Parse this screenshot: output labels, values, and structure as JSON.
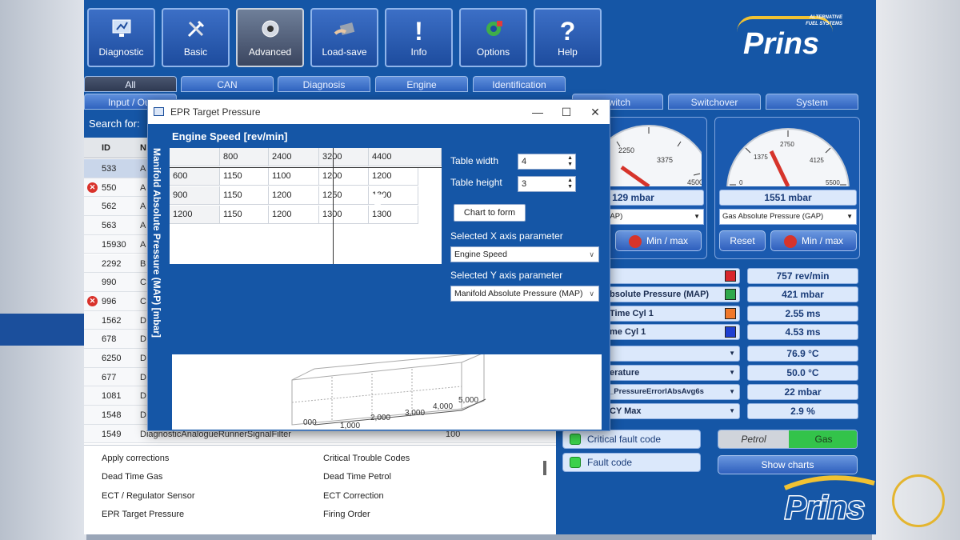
{
  "toolbar": {
    "buttons": [
      {
        "label": "Diagnostic",
        "icon": "monitor-icon"
      },
      {
        "label": "Basic",
        "icon": "wrench-icon"
      },
      {
        "label": "Advanced",
        "icon": "gear-knob-icon"
      },
      {
        "label": "Load-save",
        "icon": "hand-disk-icon"
      },
      {
        "label": "Info",
        "icon": "exclamation-icon"
      },
      {
        "label": "Options",
        "icon": "options-icon"
      },
      {
        "label": "Help",
        "icon": "question-icon"
      }
    ],
    "active": "Advanced"
  },
  "logo": {
    "name": "Prins",
    "tagline_1": "ALTERNATIVE",
    "tagline_2": "FUEL SYSTEMS"
  },
  "tabs_top": [
    "All",
    "CAN",
    "Diagnosis",
    "Engine",
    "Identification"
  ],
  "tabs_second": [
    "Input / Out",
    "witch",
    "Switchover",
    "System"
  ],
  "search": {
    "label": "Search for:"
  },
  "id_table": {
    "headers": [
      "ID",
      "N"
    ],
    "rows": [
      {
        "id": "533",
        "name": "A",
        "error": false,
        "selected": true
      },
      {
        "id": "550",
        "name": "A",
        "error": true
      },
      {
        "id": "562",
        "name": "A",
        "error": false
      },
      {
        "id": "563",
        "name": "A",
        "error": false
      },
      {
        "id": "15930",
        "name": "A",
        "error": false
      },
      {
        "id": "2292",
        "name": "B",
        "error": false
      },
      {
        "id": "990",
        "name": "C",
        "error": false
      },
      {
        "id": "996",
        "name": "C",
        "error": true
      },
      {
        "id": "1562",
        "name": "D",
        "error": false
      },
      {
        "id": "678",
        "name": "D",
        "error": false
      },
      {
        "id": "6250",
        "name": "D",
        "error": false
      },
      {
        "id": "677",
        "name": "D",
        "error": false
      },
      {
        "id": "1081",
        "name": "D",
        "error": false
      },
      {
        "id": "1548",
        "name": "D",
        "error": false
      },
      {
        "id": "1549",
        "name": "DiagnosticAnalogueRunnerSignalFilter",
        "error": false,
        "value": "100"
      }
    ]
  },
  "descriptions": [
    "Apply corrections",
    "Critical Trouble Codes",
    "Dead Time Gas",
    "Dead Time Petrol",
    "ECT / Regulator Sensor",
    "ECT Correction",
    "EPR Target Pressure",
    "Firing Order"
  ],
  "gauges": [
    {
      "ticks": [
        "2250",
        "3375",
        "4500"
      ],
      "value": "129 mbar",
      "select": "sure (GAP-MAP)",
      "minmax": "Min / max"
    },
    {
      "ticks": [
        "0",
        "1375",
        "2750",
        "4125",
        "5500"
      ],
      "value": "1551 mbar",
      "select": "Gas Absolute Pressure (GAP)",
      "reset": "Reset",
      "minmax": "Min / max"
    }
  ],
  "params": [
    {
      "label": "",
      "color": "#d8262c",
      "reading": "757 rev/min"
    },
    {
      "label": "bsolute Pressure (MAP)",
      "color": "#2fa84a",
      "reading": "421 mbar"
    },
    {
      "label": "Time Cyl 1",
      "color": "#f0782a",
      "reading": "2.55 ms"
    },
    {
      "label": "me Cyl 1",
      "color": "#1f3fd0",
      "reading": "4.53 ms"
    },
    {
      "label": "",
      "reading": "76.9 °C"
    },
    {
      "label": "erature",
      "reading": "50.0 °C"
    },
    {
      "label": "_PressureErrorIAbsAvg6s",
      "reading": "22 mbar"
    },
    {
      "label": "CY Max",
      "reading": "2.9 %"
    }
  ],
  "faults": {
    "critical": "Critical fault code",
    "fault": "Fault code"
  },
  "fuel": {
    "petrol": "Petrol",
    "gas": "Gas"
  },
  "show_charts": "Show charts",
  "dialog": {
    "title": "EPR Target Pressure",
    "x_axis_label": "Engine Speed [rev/min]",
    "y_axis_label": "Manifold Absolute Pressure (MAP) [mbar]",
    "columns": [
      "800",
      "2400",
      "3200",
      "4400"
    ],
    "rows": [
      {
        "map": "600",
        "values": [
          "1150",
          "1100",
          "1200",
          "1200"
        ]
      },
      {
        "map": "900",
        "values": [
          "1150",
          "1200",
          "1250",
          "1300"
        ]
      },
      {
        "map": "1200",
        "values": [
          "1150",
          "1200",
          "1300",
          "1300"
        ]
      }
    ],
    "table_width_label": "Table width",
    "table_width": "4",
    "table_height_label": "Table height",
    "table_height": "3",
    "chart_to_form": "Chart to form",
    "x_param_label": "Selected X axis parameter",
    "x_param": "Engine Speed",
    "y_param_label": "Selected Y axis parameter",
    "y_param": "Manifold Absolute Pressure (MAP)",
    "chart_ticks": [
      "1,000",
      "2,000",
      "3,000",
      "4,000",
      "5,000"
    ],
    "chart_tick_partial": "000"
  }
}
